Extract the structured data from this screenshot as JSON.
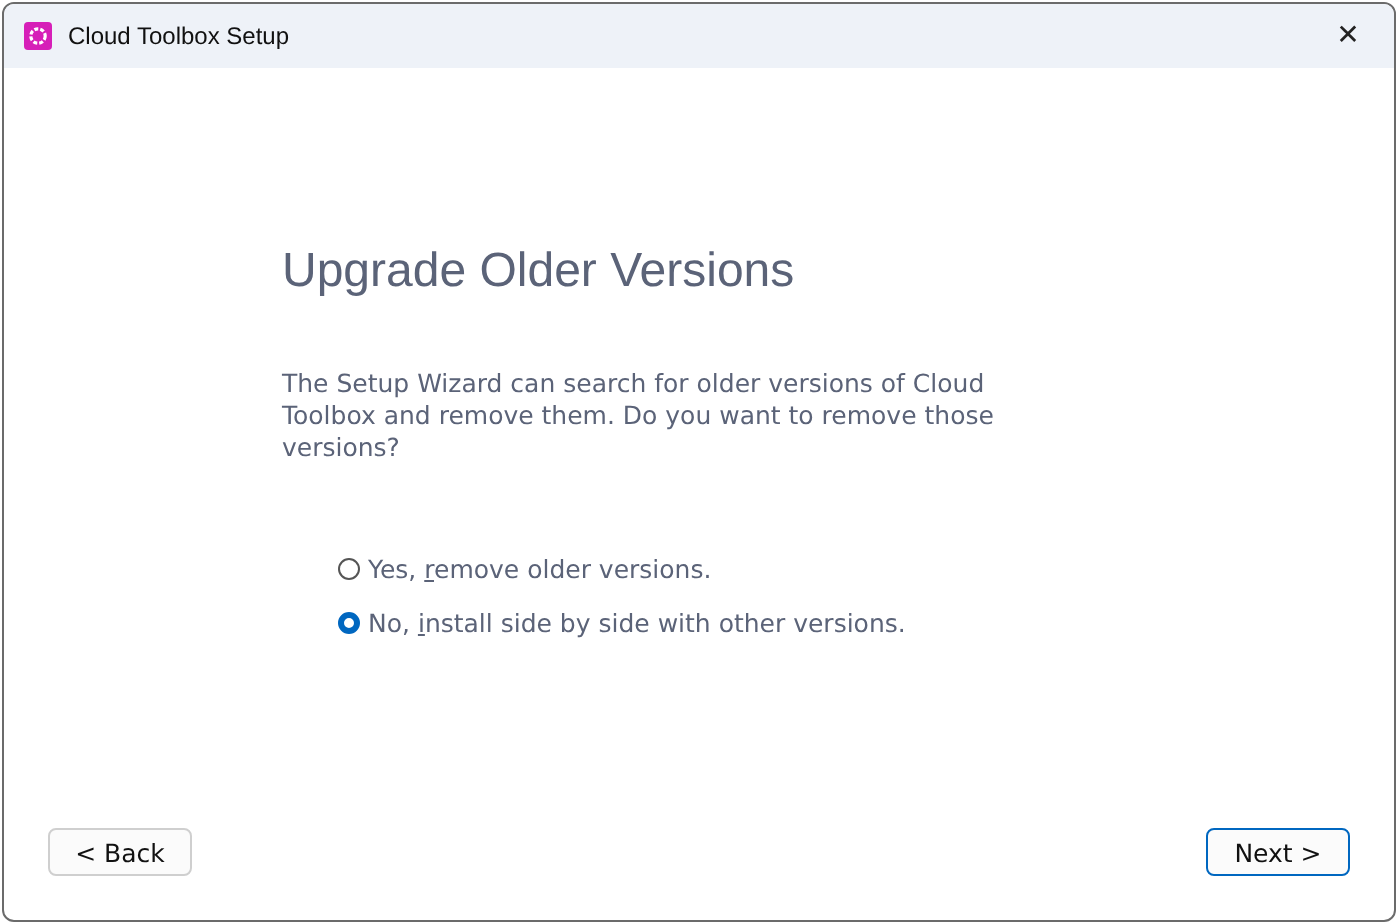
{
  "window": {
    "title": "Cloud Toolbox Setup",
    "close": "✕"
  },
  "heading": "Upgrade Older Versions",
  "description": "The Setup Wizard can search for older versions of Cloud Toolbox and remove them. Do you want to remove those versions?",
  "options": [
    {
      "pre": "Yes, ",
      "key": "r",
      "post": "emove older versions.",
      "selected": false
    },
    {
      "pre": "No, ",
      "key": "i",
      "post": "nstall side by side with other versions.",
      "selected": true
    }
  ],
  "buttons": [
    {
      "label": "< Back",
      "default": false
    },
    {
      "label": "Next >",
      "default": true
    }
  ]
}
